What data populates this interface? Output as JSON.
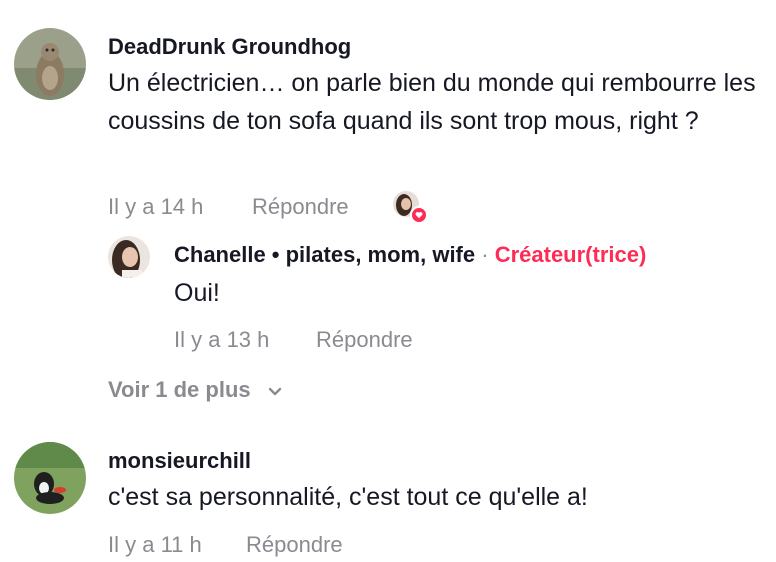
{
  "comments": [
    {
      "username": "DeadDrunk Groundhog",
      "text": "Un électricien… on parle bien du monde qui rembourre les coussins de ton sofa quand ils sont trop mous, right ?",
      "time": "Il y a 14 h",
      "reply_label": "Répondre",
      "avatar_icon": "groundhog-photo",
      "liked_by_creator": true,
      "replies": [
        {
          "username": "Chanelle • pilates, mom, wife",
          "separator": "·",
          "badge": "Créateur(trice)",
          "text": "Oui!",
          "time": "Il y a 13 h",
          "reply_label": "Répondre",
          "avatar_icon": "woman-photo"
        }
      ],
      "more_label": "Voir 1 de plus"
    },
    {
      "username": "monsieurchill",
      "text": "c'est sa personnalité, c'est tout ce qu'elle a!",
      "time": "Il y a 11 h",
      "reply_label": "Répondre",
      "avatar_icon": "dog-photo"
    }
  ],
  "colors": {
    "accent": "#fe2c55",
    "muted": "#8a8b91",
    "text": "#161823"
  }
}
